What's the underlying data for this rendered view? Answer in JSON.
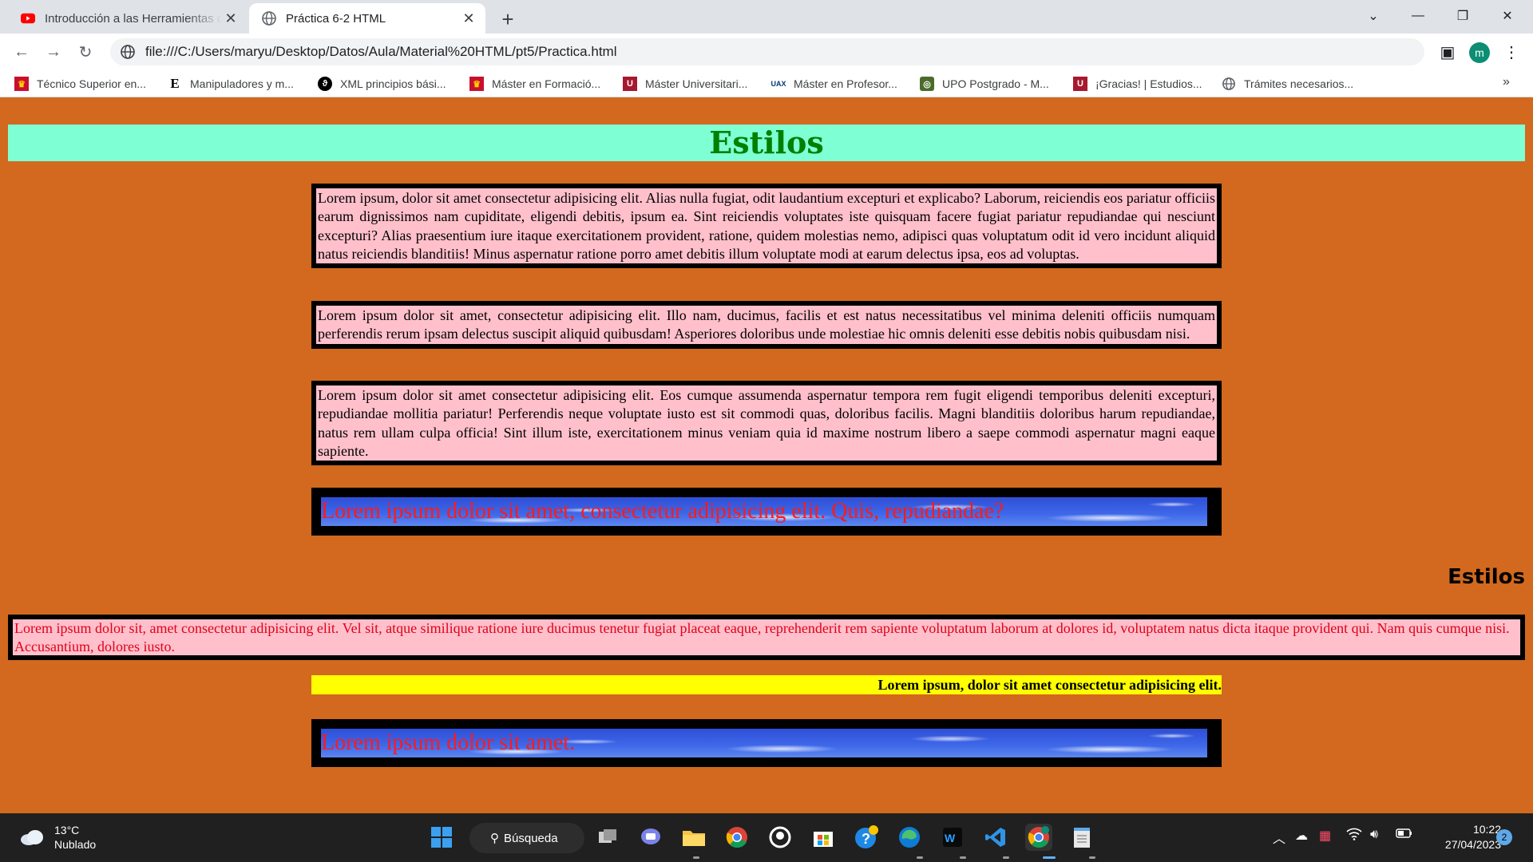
{
  "browser": {
    "tabs": [
      {
        "title": "Introducción a las Herramientas de",
        "favicon": "youtube-icon",
        "active": false
      },
      {
        "title": "Práctica 6-2 HTML",
        "favicon": "globe-icon",
        "active": true
      }
    ],
    "url": "file:///C:/Users/maryu/Desktop/Datos/Aula/Material%20HTML/pt5/Practica.html",
    "profile_initial": "m",
    "bookmarks": [
      {
        "label": "Técnico Superior en...",
        "icon": "spain-crest-icon"
      },
      {
        "label": "Manipuladores y m...",
        "icon": "e-letter-icon"
      },
      {
        "label": "XML principios bási...",
        "icon": "feather-icon"
      },
      {
        "label": "Máster en Formació...",
        "icon": "spain-crest-icon"
      },
      {
        "label": "Máster Universitari...",
        "icon": "university-icon"
      },
      {
        "label": "Máster en Profesor...",
        "icon": "uax-icon"
      },
      {
        "label": "UPO Postgrado - M...",
        "icon": "upo-icon"
      },
      {
        "label": "¡Gracias! | Estudios...",
        "icon": "university-icon"
      },
      {
        "label": "Trámites necesarios...",
        "icon": "globe-icon"
      }
    ]
  },
  "page": {
    "heading": "Estilos",
    "paragraphs": [
      "Lorem ipsum, dolor sit amet consectetur adipisicing elit. Alias nulla fugiat, odit laudantium excepturi et explicabo? Laborum, reiciendis eos pariatur officiis earum dignissimos nam cupiditate, eligendi debitis, ipsum ea. Sint reiciendis voluptates iste quisquam facere fugiat pariatur repudiandae qui nesciunt excepturi? Alias praesentium iure itaque exercitationem provident, ratione, quidem molestias nemo, adipisci quas voluptatum odit id vero incidunt aliquid natus reiciendis blanditiis! Minus aspernatur ratione porro amet debitis illum voluptate modi at earum delectus ipsa, eos ad voluptas.",
      "Lorem ipsum dolor sit amet, consectetur adipisicing elit. Illo nam, ducimus, facilis et est natus necessitatibus vel minima deleniti officiis numquam perferendis rerum ipsam delectus suscipit aliquid quibusdam! Asperiores doloribus unde molestiae hic omnis deleniti esse debitis nobis quibusdam nisi.",
      "Lorem ipsum dolor sit amet consectetur adipisicing elit. Eos cumque assumenda aspernatur tempora rem fugit eligendi temporibus deleniti excepturi, repudiandae mollitia pariatur! Perferendis neque voluptate iusto est sit commodi quas, doloribus facilis. Magni blanditiis doloribus harum repudiandae, natus rem ullam culpa officia! Sint illum iste, exercitationem minus veniam quia id maxime nostrum libero a saepe commodi aspernatur magni eaque sapiente."
    ],
    "sky_text_1": "Lorem ipsum dolor sit amet, consectetur adipisicing elit. Quis, repudiandae?",
    "heading_right": "Estilos",
    "red_paragraph": "Lorem ipsum dolor sit, amet consectetur adipisicing elit. Vel sit, atque similique ratione iure ducimus tenetur fugiat placeat eaque, reprehenderit rem sapiente voluptatum laborum at dolores id, voluptatem natus dicta itaque provident qui. Nam quis cumque nisi. Accusantium, dolores iusto.",
    "yellow_text": "Lorem ipsum, dolor sit amet consectetur adipisicing elit.",
    "sky_text_2": "Lorem ipsum dolor sit amet."
  },
  "taskbar": {
    "weather_temp": "13°C",
    "weather_desc": "Nublado",
    "search_label": "Búsqueda",
    "time": "10:22",
    "date": "27/04/2023",
    "notifications": "2"
  },
  "colors": {
    "page_bg": "#d2691e",
    "heading_bg": "#7fffd4",
    "heading_text": "#008000",
    "para_bg": "#ffc0cb",
    "red_text": "#e0001a",
    "yellow": "#ffff00"
  }
}
